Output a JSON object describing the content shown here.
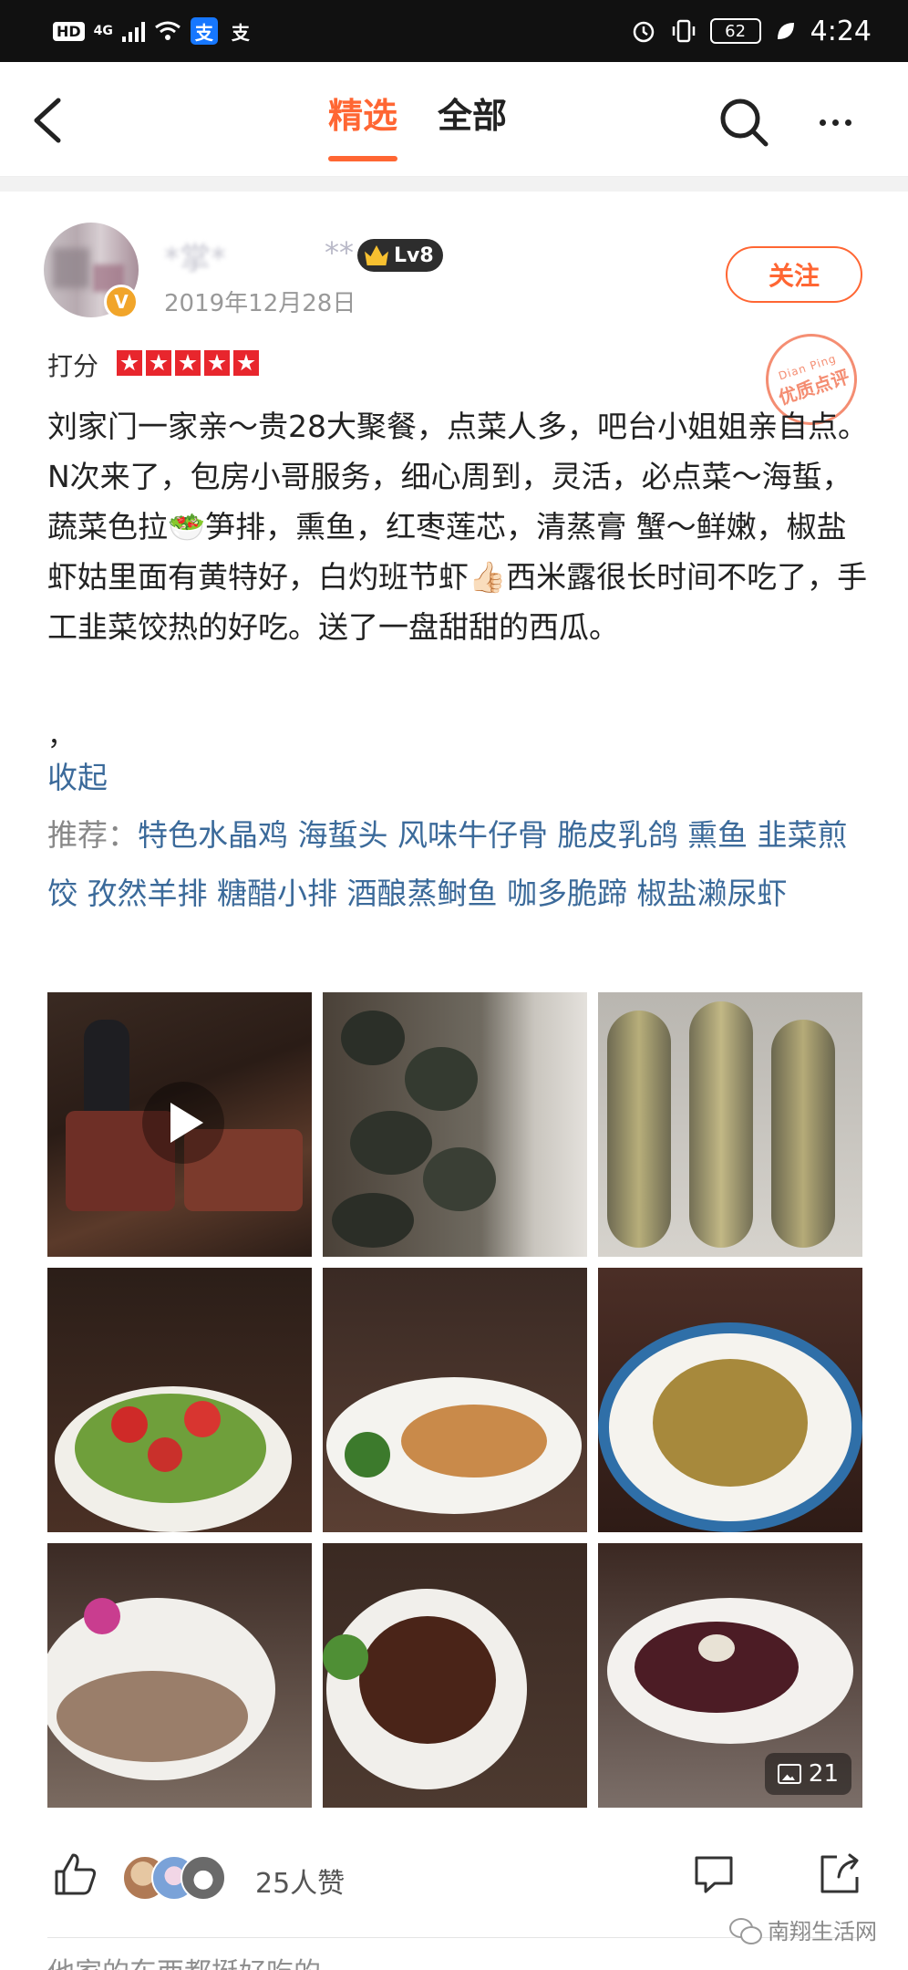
{
  "status_bar": {
    "hd": "HD",
    "network": "4G",
    "alipay_glyph": "支",
    "app2_glyph": "支",
    "battery": "62",
    "time": "4:24"
  },
  "nav": {
    "tabs": [
      {
        "label": "精选",
        "active": true
      },
      {
        "label": "全部",
        "active": false
      }
    ]
  },
  "review": {
    "username_masked": "*掌*",
    "username_tail": "**",
    "level": "Lv8",
    "date": "2019年12月28日",
    "follow_label": "关注",
    "verify_glyph": "V",
    "score_label": "打分",
    "stars": 5,
    "stamp_top": "Dian Ping",
    "stamp_main": "优质点评",
    "text": "刘家门一家亲～贵28大聚餐，点菜人多，吧台小姐姐亲自点。N次来了，包房小哥服务，细心周到，灵活，必点菜～海蜇，蔬菜色拉🥗笋排，熏鱼，红枣莲芯，清蒸膏 蟹～鲜嫩，椒盐虾姑里面有黄特好，白灼班节虾👍🏻西米露很长时间不吃了，手工韭菜饺热的好吃。送了一盘甜甜的西瓜。",
    "comma": "，",
    "collapse_label": "收起",
    "recommend_label": "推荐：",
    "recommended": [
      "特色水晶鸡",
      "海蜇头",
      "风味牛仔骨",
      "脆皮乳鸽",
      "熏鱼",
      "韭菜煎饺",
      "孜然羊排",
      "糖醋小排",
      "酒酿蒸鲥鱼",
      "咖多脆蹄",
      "椒盐濑尿虾"
    ],
    "photo_count": "21"
  },
  "actions": {
    "like_count": "25人赞"
  },
  "watermark": "南翔生活网",
  "next_peek": "他家的东西都挺好吃的…"
}
